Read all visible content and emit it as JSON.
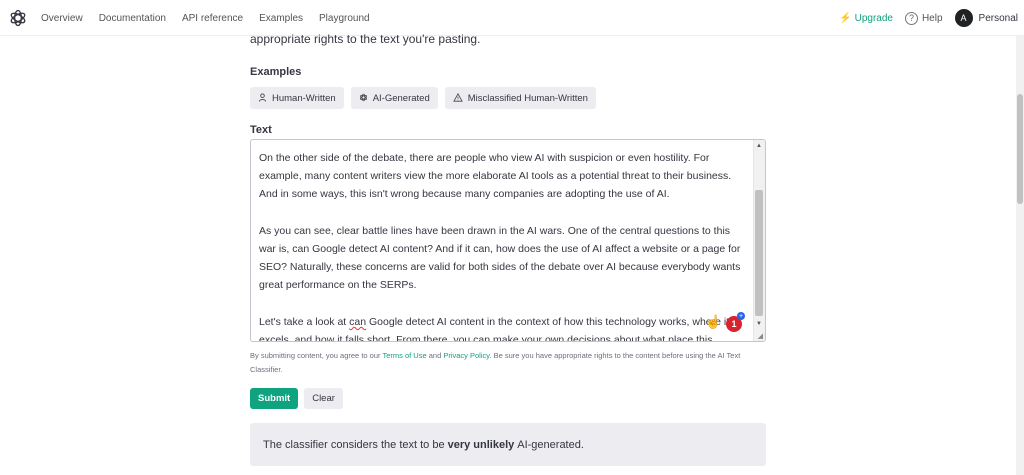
{
  "nav": {
    "links": [
      "Overview",
      "Documentation",
      "API reference",
      "Examples",
      "Playground"
    ],
    "upgrade": "Upgrade",
    "help": "Help",
    "avatar_initial": "A",
    "account": "Personal"
  },
  "intro_tail": "appropriate rights to the text you're pasting.",
  "examples": {
    "heading": "Examples",
    "buttons": [
      {
        "label": "Human-Written",
        "icon": "person-icon"
      },
      {
        "label": "AI-Generated",
        "icon": "openai-icon"
      },
      {
        "label": "Misclassified Human-Written",
        "icon": "warning-icon"
      }
    ]
  },
  "text_section": {
    "heading": "Text",
    "paragraphs": [
      "On the other side of the debate, there are people who view AI with suspicion or even hostility. For example, many content writers view the more elaborate AI tools as a potential threat to their business. And in some ways, this isn't wrong because many companies are adopting the use of AI.",
      "As you can see, clear battle lines have been drawn in the AI wars. One of the central questions to this war is, can Google detect AI content? And if it can, how does the use of AI affect a website or a page for SEO? Naturally, these concerns are valid for both sides of the debate over AI because everybody wants great performance on the SERPs."
    ],
    "para3_before": "Let's take a look at ",
    "para3_misspelled": "can",
    "para3_after": " Google detect AI content in the context of how this technology works, where it excels, and how it falls short. From there, you can make your own decisions about what place this technology may have in your marketing and content creation efforts.",
    "extension_badge_count": "1",
    "extension_plus": "+"
  },
  "disclaimer": {
    "prefix": "By submitting content, you agree to our ",
    "terms": "Terms of Use",
    "and": " and ",
    "privacy": "Privacy Policy",
    "suffix": ". Be sure you have appropriate rights to the content before using the AI Text Classifier."
  },
  "buttons": {
    "submit": "Submit",
    "clear": "Clear"
  },
  "result": {
    "prefix": "The classifier considers the text to be",
    "verdict": "very unlikely",
    "suffix": "AI-generated."
  },
  "colors": {
    "accent": "#10a37f",
    "badge": "#d9232e"
  }
}
